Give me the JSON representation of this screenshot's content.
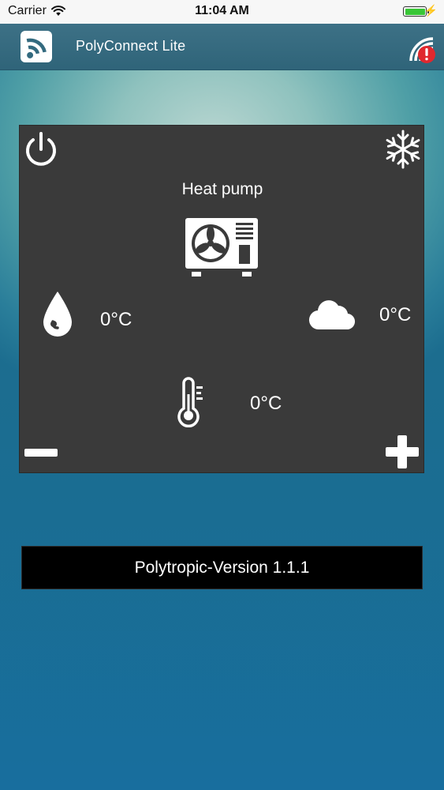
{
  "status_bar": {
    "carrier": "Carrier",
    "time": "11:04 AM",
    "icons": [
      "wifi-icon",
      "battery-icon",
      "charging-bolt-icon"
    ]
  },
  "nav": {
    "title": "PolyConnect Lite",
    "logo_icon": "wifi-signal-logo-icon",
    "alert_icon": "connection-warning-icon"
  },
  "panel": {
    "device_label": "Heat pump",
    "water_temp": "0°C",
    "outdoor_temp": "0°C",
    "indoor_temp": "0°C",
    "icons": {
      "power": "power-icon",
      "mode": "snowflake-icon",
      "device": "heat-pump-unit-icon",
      "water": "water-drop-icon",
      "outdoor": "cloud-icon",
      "indoor": "thermometer-icon",
      "decrease": "minus-icon",
      "increase": "plus-icon"
    }
  },
  "version": {
    "label": "Polytropic-Version 1.1.1"
  },
  "colors": {
    "nav_bg": "#336a7f",
    "panel_bg": "#3a3a3a",
    "version_bg": "#000000",
    "text": "#ffffff",
    "alert_red": "#e0282e",
    "battery_green": "#38c636"
  }
}
